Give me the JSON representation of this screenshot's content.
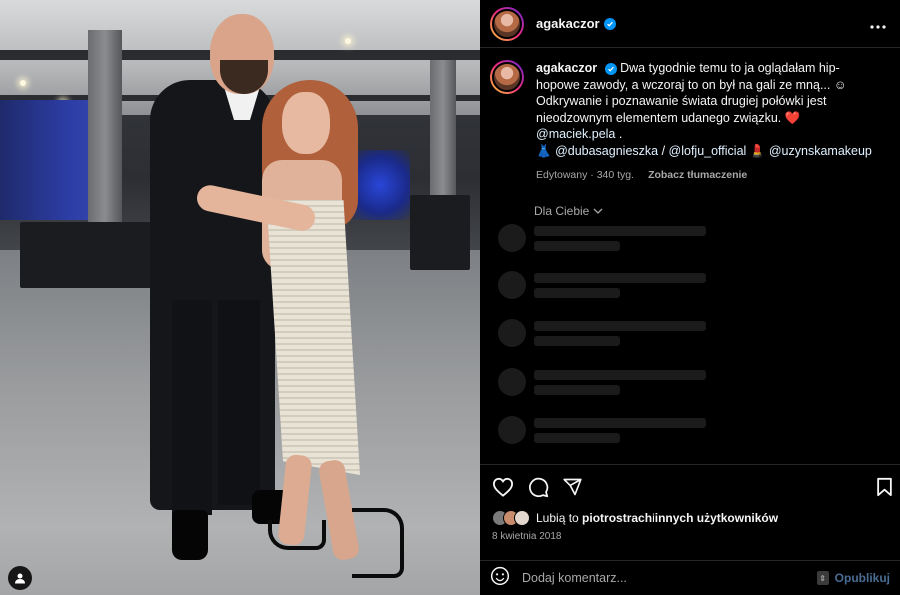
{
  "post": {
    "username": "agakaczor",
    "caption_parts": {
      "text1": "Dwa tygodnie temu to ja oglądałam hip-hopowe zawody, a wczoraj to on był na gali ze mną... ☺ Odkrywanie i poznawanie świata drugiej połówki jest nieodzownym elementem udanego związku. ",
      "heart": "❤️",
      "mention1": "@maciek.pela",
      "text2": " . ",
      "dress_emoji": "👗",
      "mention2": "@dubasagnieszka",
      "sep": " / ",
      "mention3": "@lofju_official",
      "lipstick_emoji": "💄",
      "mention4": "@uzynskamakeup"
    },
    "edited": "Edytowany · 340 tyg.",
    "translate": "Zobacz tłumaczenie",
    "for_you": "Dla Ciebie"
  },
  "likes": {
    "prefix": "Lubią to ",
    "user": "piotrostrach",
    "middle": " i ",
    "others": "innych użytkowników"
  },
  "date": "8 kwietnia 2018",
  "comment": {
    "placeholder": "Dodaj komentarz...",
    "publish": "Opublikuj"
  },
  "icons": [
    "more-icon",
    "verified-icon",
    "heart-icon",
    "comment-icon",
    "share-icon",
    "bookmark-icon",
    "emoji-icon",
    "user-tag-icon",
    "chevron-down-icon"
  ],
  "colors": {
    "accent": "#0095f6",
    "background": "#000000",
    "muted": "#a8a8a8",
    "publish_disabled": "#4a6c93"
  }
}
